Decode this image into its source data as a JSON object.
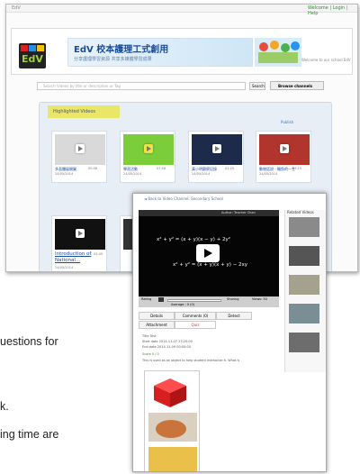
{
  "back_window": {
    "tab_label": "EdV",
    "top_links": "Welcome | Login | Help",
    "logo_text": "EdV",
    "banner_title": "EdV 校本護理工式創用",
    "banner_subtitle": "分享護理學習資源  共享多媒體學習成果",
    "welcome_text": "Welcome to our school EdV",
    "search_placeholder": "Search Videos by title or description or Tag",
    "search_button": "Search",
    "browse_button": "Browse channels",
    "panel_title": "Highlighted Videos",
    "view_link": "Publish",
    "tiles": [
      {
        "title": "多面體展開圖",
        "duration": "00:58",
        "date": "24/05/2014"
      },
      {
        "title": "學習活動",
        "duration": "07:56",
        "date": "24/05/2014"
      },
      {
        "title": "黃小明觀察記錄",
        "duration": "01:25",
        "date": "24/05/2014"
      },
      {
        "title": "動物話說 - 鱷魚的一生",
        "duration": "03:15",
        "date": "24/05/2014"
      },
      {
        "title": "Introduction of",
        "subtitle": "National...",
        "duration": "03:45",
        "date": "24/05/2014"
      }
    ]
  },
  "front_window": {
    "breadcrumb": "◄ Back to Video Channel: Secondary School",
    "player_header": "Author: Teacher Chan",
    "equation_1": "x² + y² = (x + y)(x − y) + 2y²",
    "equation_2": "x² + y² = (x + y)(x + y) − 2xy",
    "related_title": "Related Videos",
    "rating_label": "Rating",
    "average_label": "Average : 0 (0)",
    "sharing_label": "Sharing",
    "views_label": "Views: 50",
    "tabs": [
      "Details",
      "Comments (0)",
      "Detect",
      "Attachment",
      "Quiz"
    ],
    "form_rows": [
      "Title    Test",
      "Start date  2014-11-07 23:20:00",
      "End date   2014-11-09 00:00:00",
      "Score    0 / 0"
    ],
    "question_text": "This is used as an object to help student memorize it. What is"
  },
  "caption_fragments": [
    "uestions  for",
    "k.",
    "ing  time  are"
  ]
}
